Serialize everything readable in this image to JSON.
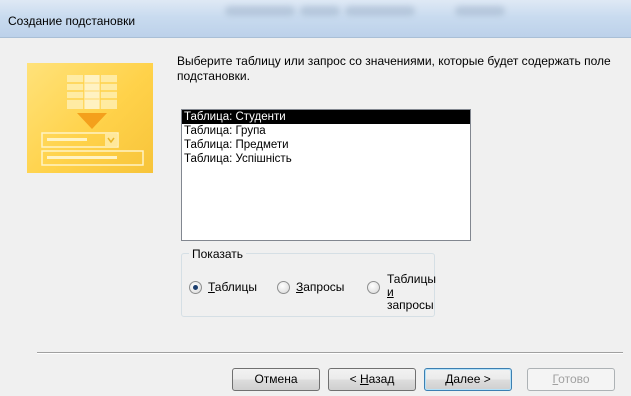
{
  "window": {
    "title": "Создание подстановки"
  },
  "instruction": "Выберите таблицу или запрос со значениями, которые будет содержать поле подстановки.",
  "list": {
    "items": [
      "Таблица: Студенти",
      "Таблица: Група",
      "Таблица: Предмети",
      "Таблица: Успішність"
    ],
    "selected_index": 0
  },
  "show_group": {
    "legend": "Показать",
    "options": {
      "tables": {
        "prefix": "",
        "accel": "Т",
        "rest": "аблицы"
      },
      "queries": {
        "prefix": "",
        "accel": "З",
        "rest": "апросы"
      },
      "both_line1_prefix": "Таблицы ",
      "both_line1_accel": "и",
      "both_line2": "запросы"
    },
    "selected": "tables"
  },
  "buttons": {
    "cancel": "Отмена",
    "back_prefix": "< ",
    "back_accel": "Н",
    "back_rest": "азад",
    "next_accel": "Д",
    "next_rest": "алее >",
    "finish_accel": "Г",
    "finish_rest": "отово"
  },
  "colors": {
    "art_yellow": "#ffd24a",
    "selection": "#000000",
    "default_button_border": "#3c7fb1"
  }
}
